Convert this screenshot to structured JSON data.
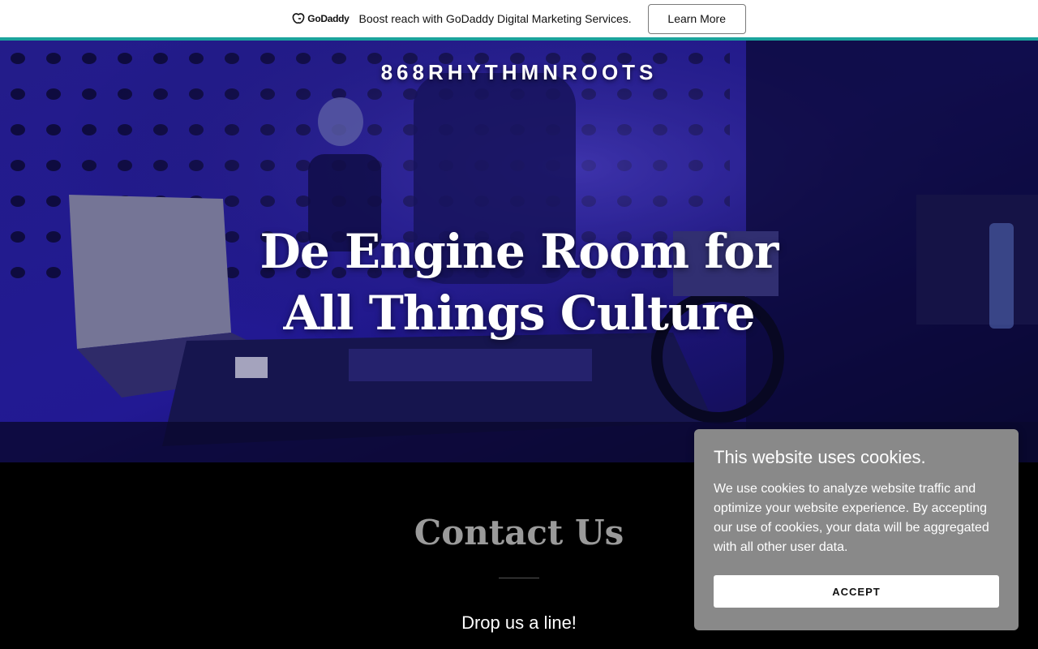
{
  "promo": {
    "logo_text": "GoDaddy",
    "message": "Boost reach with GoDaddy Digital Marketing Services.",
    "button_label": "Learn More"
  },
  "hero": {
    "site_title": "868RHYTHMNROOTS",
    "headline": "De Engine Room for All Things Culture"
  },
  "contact": {
    "title": "Contact Us",
    "subtitle": "Drop us a line!"
  },
  "cookie": {
    "title": "This website uses cookies.",
    "body": "We use cookies to analyze website traffic and optimize your website experience. By accepting our use of cookies, your data will be aggregated with all other user data.",
    "accept_label": "ACCEPT"
  },
  "colors": {
    "accent": "#1ba39c",
    "hero_tint": "#2a1fb0",
    "cookie_bg": "#898989"
  }
}
